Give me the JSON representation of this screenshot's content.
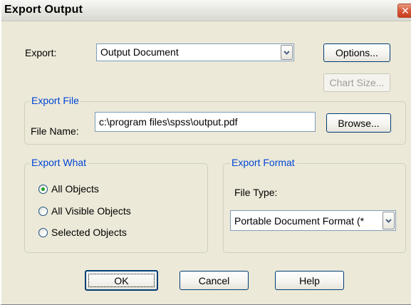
{
  "window": {
    "title": "Export Output",
    "close_glyph": "✕"
  },
  "export": {
    "label": "Export:",
    "selected": "Output Document"
  },
  "buttons": {
    "options": "Options...",
    "chart_size": "Chart Size...",
    "browse": "Browse...",
    "ok": "OK",
    "cancel": "Cancel",
    "help": "Help"
  },
  "export_file": {
    "legend": "Export File",
    "file_name_label": "File Name:",
    "file_name_value": "c:\\program files\\spss\\output.pdf"
  },
  "export_what": {
    "legend": "Export What",
    "options": [
      {
        "label": "All Objects",
        "selected": true
      },
      {
        "label": "All Visible Objects",
        "selected": false
      },
      {
        "label": "Selected Objects",
        "selected": false
      }
    ]
  },
  "export_format": {
    "legend": "Export Format",
    "file_type_label": "File Type:",
    "file_type_selected": "Portable Document Format (*"
  },
  "colors": {
    "dialog_bg": "#ece9d8",
    "group_legend": "#0046d5",
    "radio_selected": "#21a121",
    "button_border": "#003c74"
  }
}
